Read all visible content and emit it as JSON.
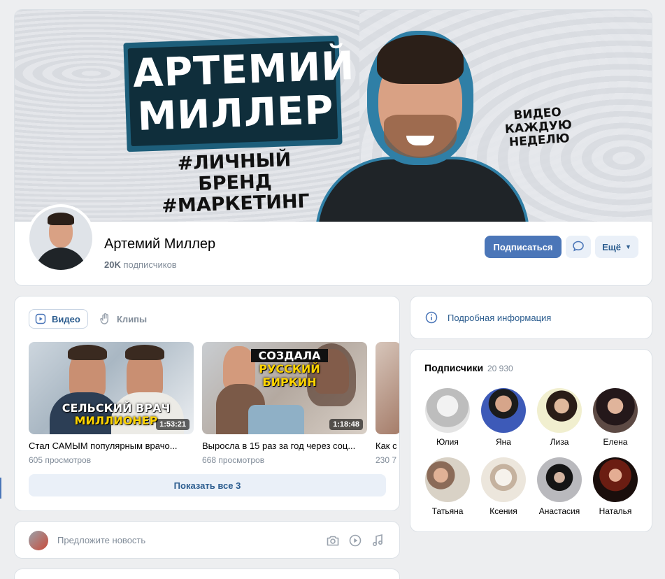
{
  "profile": {
    "cover": {
      "title_line1": "АРТЕМИЙ",
      "title_line2": "МИЛЛЕР",
      "tag1": "#ЛИЧНЫЙ БРЕНД",
      "tag2": "#МАРКЕТИНГ",
      "week_line1": "ВИДЕО КАЖДУЮ",
      "week_line2": "НЕДЕЛЮ"
    },
    "name": "Артемий Миллер",
    "subs_count": "20K",
    "subs_label": "подписчиков",
    "subscribe_label": "Подписаться",
    "more_label": "Ещё"
  },
  "videos": {
    "tabs": [
      {
        "label": "Видео",
        "icon": "play-square-icon",
        "active": true
      },
      {
        "label": "Клипы",
        "icon": "clips-hand-icon",
        "active": false
      }
    ],
    "items": [
      {
        "title": "Стал САМЫМ популярным врачо...",
        "views": "605 просмотров",
        "duration": "1:53:21",
        "caption_line1": "СЕЛЬСКИЙ ВРАЧ",
        "caption_line2": "МИЛЛИОНЕР"
      },
      {
        "title": "Выросла в 15 раз за год через соц...",
        "views": "668 просмотров",
        "duration": "1:18:48",
        "caption_line1": "СОЗДАЛА",
        "caption_line2": "РУССКИЙ",
        "caption_line3": "БИРКИН"
      },
      {
        "title": "Как с",
        "views": "230 7"
      }
    ],
    "show_all_label": "Показать все 3"
  },
  "suggest": {
    "placeholder": "Предложите новость",
    "icons": [
      "camera-icon",
      "video-icon",
      "music-icon"
    ]
  },
  "info": {
    "label": "Подробная информация"
  },
  "followers": {
    "title": "Подписчики",
    "count": "20 930",
    "people": [
      {
        "name": "Юлия",
        "color": "#d8d8d8"
      },
      {
        "name": "Яна",
        "color": "#6a7fb5"
      },
      {
        "name": "Лиза",
        "color": "#e9e7c8"
      },
      {
        "name": "Елена",
        "color": "#3a2c26"
      },
      {
        "name": "Татьяна",
        "color": "#c9b8a3"
      },
      {
        "name": "Ксения",
        "color": "#e6ded4"
      },
      {
        "name": "Анастасия",
        "color": "#a8a8ac"
      },
      {
        "name": "Наталья",
        "color": "#2b1512"
      }
    ]
  },
  "colors": {
    "accent": "#4b76b8",
    "link": "#2c5d8f",
    "background": "#edeef0"
  }
}
